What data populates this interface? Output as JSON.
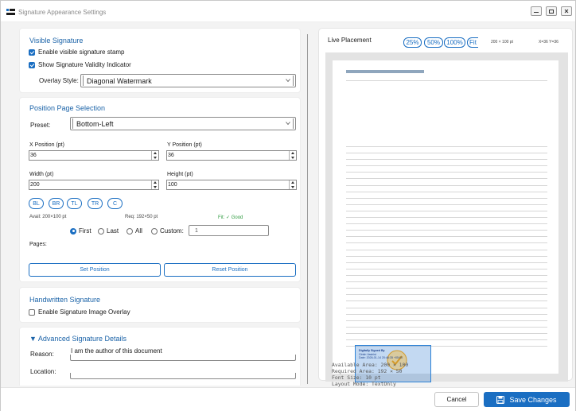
{
  "window": {
    "title": "Signature Appearance Settings",
    "app_icon": "settings-app-icon",
    "controls": [
      "minimize-icon",
      "restore-icon",
      "close-icon"
    ]
  },
  "visible_signature": {
    "title": "Visible Signature",
    "enable_stamp": {
      "label": "Enable visible signature stamp",
      "checked": true
    },
    "show_validity": {
      "label": "Show Signature Validity Indicator",
      "checked": true
    },
    "overlay_style_label": "Overlay Style:",
    "overlay_style_value": "Diagonal Watermark"
  },
  "position": {
    "title": "Position  Page Selection",
    "preset_label": "Preset:",
    "preset_value": "Bottom-Left",
    "x_label": "X Position (pt)",
    "x_value": "36",
    "y_label": "Y Position (pt)",
    "y_value": "36",
    "width_label": "Width (pt)",
    "width_value": "200",
    "height_label": "Height (pt)",
    "height_value": "100",
    "quick_buttons": [
      "BL",
      "BR",
      "TL",
      "TR",
      "C"
    ],
    "avail": "Avail: 200×100 pt",
    "req": "Req: 192×50 pt",
    "fit": "Fit: ✓ Good",
    "fit_color": "#2e9a3f",
    "pages_label": "Pages:",
    "page_options": [
      {
        "label": "First",
        "selected": true
      },
      {
        "label": "Last",
        "selected": false
      },
      {
        "label": "All",
        "selected": false
      },
      {
        "label": "Custom:",
        "selected": false
      }
    ],
    "custom_value": "1",
    "set_button": "Set Position",
    "reset_button": "Reset Position"
  },
  "handwritten": {
    "title": "Handwritten Signature",
    "enable_overlay": {
      "label": "Enable Signature Image Overlay",
      "checked": false
    }
  },
  "advanced": {
    "title": "▼ Advanced Signature Details",
    "reason_label": "Reason:",
    "reason_value": "I am the author of this document",
    "location_label": "Location:",
    "location_value": ""
  },
  "preview": {
    "title": "Live Placement",
    "zoom_options": [
      "25%",
      "50%",
      "100%",
      "Fit"
    ],
    "size_readout": "200 × 100 pt",
    "coords_readout": "X=36 Y=36",
    "signature_lines": [
      "Digitally Signed By",
      "Girish Vashist",
      "Date: 2026-01-14 20:46:35 +05:00"
    ],
    "info_lines": [
      "Available Area: 200 × 100",
      "Required Area: 192 × 50",
      "Font Size: 10 pt",
      "Layout Mode: TextOnly"
    ]
  },
  "footer": {
    "cancel": "Cancel",
    "save": "Save Changes"
  },
  "colors": {
    "accent": "#1a6ec2",
    "section_title": "#1b63a8"
  }
}
